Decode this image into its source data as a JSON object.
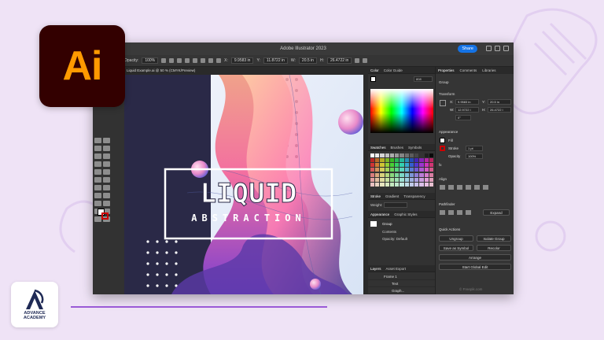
{
  "brand": {
    "app_logo_text": "Ai",
    "academy_name_line1": "ADVANCE",
    "academy_name_line2": "ACADEMY"
  },
  "window": {
    "title": "Adobe Illustrator 2023",
    "share_label": "Share",
    "doc_tab": "Liquid Example.ai @ 50 % (CMYK/Preview)"
  },
  "control_bar": {
    "opacity_label": "Opacity:",
    "opacity_value": "100%",
    "width_value": "9.9583 in",
    "x_value": "11.8722 in",
    "y_value": "20.5 in",
    "h_value": "26.4722 in"
  },
  "artwork": {
    "title": "LIQUID",
    "subtitle": "ABSTRACTION"
  },
  "color_panel": {
    "tabs": [
      "Color",
      "Color Guide"
    ],
    "hex_value": "808"
  },
  "swatches_panel": {
    "tabs": [
      "Swatches",
      "Brushes",
      "Symbols"
    ]
  },
  "stroke_panel": {
    "tabs": [
      "Stroke",
      "Gradient",
      "Transparency"
    ],
    "weight_label": "Weight:"
  },
  "appearance_panel": {
    "tabs": [
      "Appearance",
      "Graphic Styles"
    ],
    "group_label": "Group",
    "contents_label": "Contents",
    "opacity_row": "Opacity: Default"
  },
  "layers_panel": {
    "tabs": [
      "Layers",
      "Asset Export"
    ],
    "rows": [
      "Frame 1",
      "Text",
      "Graph..."
    ]
  },
  "properties_panel": {
    "tabs": [
      "Properties",
      "Comments",
      "Libraries"
    ],
    "selection_label": "Group",
    "transform_label": "Transform",
    "x_label": "X:",
    "x_value": "9.9583 in",
    "y_label": "Y:",
    "y_value": "20.5 in",
    "w_label": "W:",
    "w_value": "12.9722 i",
    "h_label": "H:",
    "h_value": "26.4722 i",
    "angle_value": "0°",
    "appearance_label": "Appearance",
    "fill_label": "Fill",
    "stroke_label": "Stroke",
    "stroke_weight": "1 pt",
    "opacity_label": "Opacity",
    "opacity_value": "100%",
    "fx_label": "fx",
    "align_label": "Align",
    "pathfinder_label": "Pathfinder",
    "expand_label": "Expand",
    "quick_actions_label": "Quick Actions",
    "ungroup_button": "Ungroup",
    "isolate_button": "Isolate Group",
    "save_symbol_button": "Save as Symbol",
    "recolor_button": "Recolor",
    "arrange_button": "Arrange",
    "global_edit_button": "Start Global Edit"
  },
  "watermark": "© Freepik.com",
  "colors": {
    "accent": "#9a5ad6",
    "logo_bg": "#330000",
    "logo_text": "#ff9a00",
    "share_blue": "#1473e6"
  }
}
